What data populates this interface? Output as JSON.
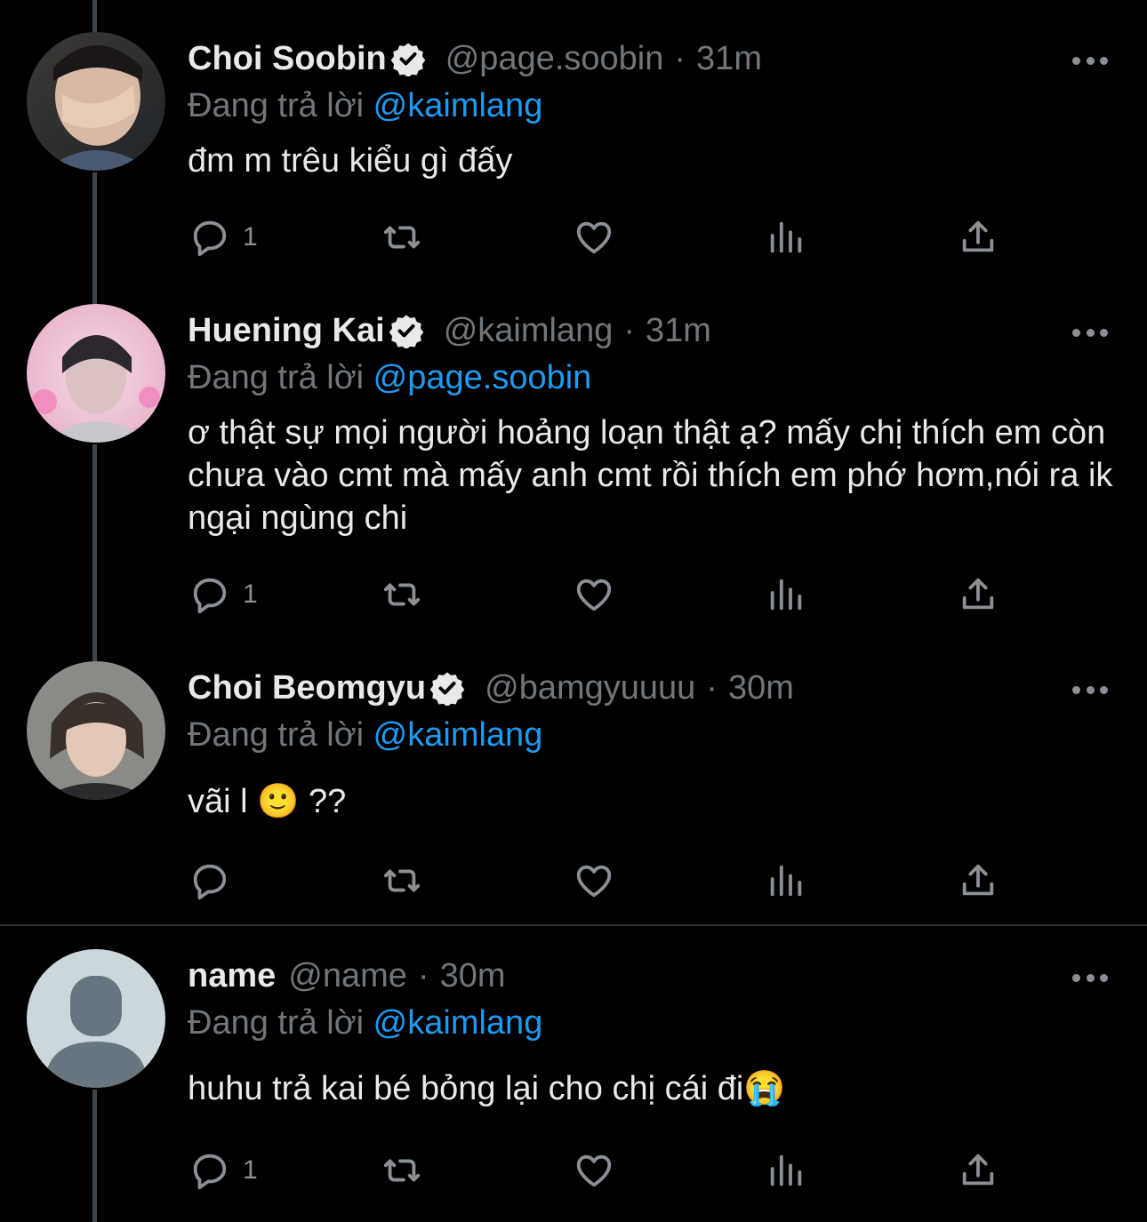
{
  "reply_prefix": "Đang trả lời",
  "tweets": [
    {
      "name": "Choi Soobin",
      "handle": "@page.soobin",
      "sep": "·",
      "time": "31m",
      "reply_to": "@kaimlang",
      "text": "đm m trêu kiểu gì đấy",
      "replies": "1",
      "verified": true,
      "avatar": "soobin-avatar"
    },
    {
      "name": "Huening Kai",
      "handle": "@kaimlang",
      "sep": "·",
      "time": "31m",
      "reply_to": "@page.soobin",
      "text": "ơ thật sự mọi người hoảng loạn thật ạ? mấy chị thích em còn chưa vào cmt mà mấy anh cmt rồi thích em phớ hơm,nói ra ik ngại ngùng chi",
      "replies": "1",
      "verified": true,
      "avatar": "kai-avatar"
    },
    {
      "name": "Choi Beomgyu",
      "handle": "@bamgyuuuu",
      "sep": "·",
      "time": "30m",
      "reply_to": "@kaimlang",
      "text": "vãi l 🙂 ??",
      "replies": "",
      "verified": true,
      "avatar": "beomgyu-avatar"
    },
    {
      "name": "name",
      "handle": "@name",
      "sep": "·",
      "time": "30m",
      "reply_to": "@kaimlang",
      "text": "huhu trả kai bé bỏng lại cho chị cái đi😭",
      "replies": "1",
      "verified": false,
      "avatar": "default-avatar"
    }
  ],
  "icons": [
    "reply-icon",
    "retweet-icon",
    "like-icon",
    "analytics-icon",
    "share-icon",
    "more-icon",
    "verified-badge-icon"
  ],
  "colors": {
    "background": "#000000",
    "text": "#e7e9ea",
    "muted": "#71767b",
    "link": "#1d9bf0",
    "thread_line": "#3f4449"
  }
}
